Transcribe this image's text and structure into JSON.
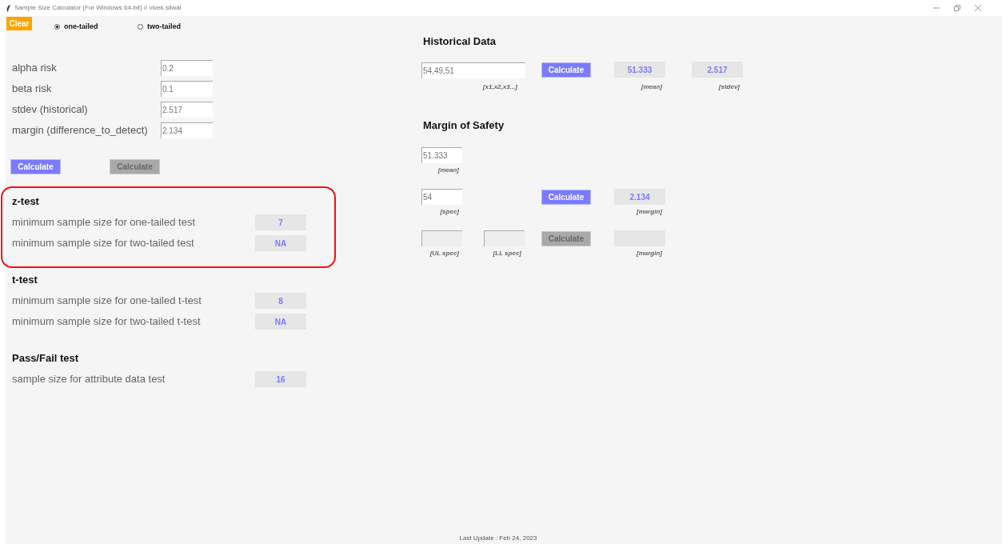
{
  "window": {
    "title": "Sample Size Calculator (For Windows 64-bit) // vivek.silwal"
  },
  "clear_button": "Clear",
  "tail_options": [
    {
      "label": "one-tailed",
      "selected": true
    },
    {
      "label": "two-tailed",
      "selected": false
    }
  ],
  "inputs": [
    {
      "label": "alpha risk",
      "value": "0.2"
    },
    {
      "label": "beta risk",
      "value": "0.1"
    },
    {
      "label": "stdev (historical)",
      "value": "2.517"
    },
    {
      "label": "margin (difference_to_detect)",
      "value": "2.134"
    }
  ],
  "calculate_buttons": [
    {
      "label": "Calculate",
      "disabled": false
    },
    {
      "label": "Calculate",
      "disabled": true
    }
  ],
  "result_sections": [
    {
      "title": "z-test",
      "highlighted": true,
      "rows": [
        {
          "label": "minimum sample size for one-tailed test",
          "value": "7"
        },
        {
          "label": "minimum sample size for two-tailed test",
          "value": "NA"
        }
      ]
    },
    {
      "title": "t-test",
      "highlighted": false,
      "rows": [
        {
          "label": "minimum sample size for one-tailed t-test",
          "value": "8"
        },
        {
          "label": "minimum sample size for two-tailed t-test",
          "value": "NA"
        }
      ]
    },
    {
      "title": "Pass/Fail test",
      "highlighted": false,
      "rows": [
        {
          "label": "sample size for attribute data test",
          "value": "16"
        }
      ]
    }
  ],
  "historical_data": {
    "title": "Historical Data",
    "input": {
      "value": "54,49,51",
      "caption": "[x1,x2,x3...]"
    },
    "button": {
      "label": "Calculate",
      "disabled": false
    },
    "outputs": [
      {
        "value": "51.333",
        "caption": "[mean]"
      },
      {
        "value": "2.517",
        "caption": "[stdev]"
      }
    ]
  },
  "margin_of_safety": {
    "title": "Margin of Safety",
    "mean_input": {
      "value": "51.333",
      "caption": "[mean]",
      "disabled": false
    },
    "spec_row": {
      "input": {
        "value": "54",
        "caption": "[spec]",
        "disabled": false
      },
      "button": {
        "label": "Calculate",
        "disabled": false
      },
      "output": {
        "value": "2.134",
        "caption": "[margin]"
      }
    },
    "limits_row": {
      "upper_input": {
        "caption": "[UL spec]",
        "disabled": true
      },
      "lower_input": {
        "caption": "[LL spec]",
        "disabled": true
      },
      "button": {
        "label": "Calculate",
        "disabled": true
      },
      "output": {
        "caption": "[margin]"
      }
    }
  },
  "footer": "Last Update : Feb 24, 2023"
}
